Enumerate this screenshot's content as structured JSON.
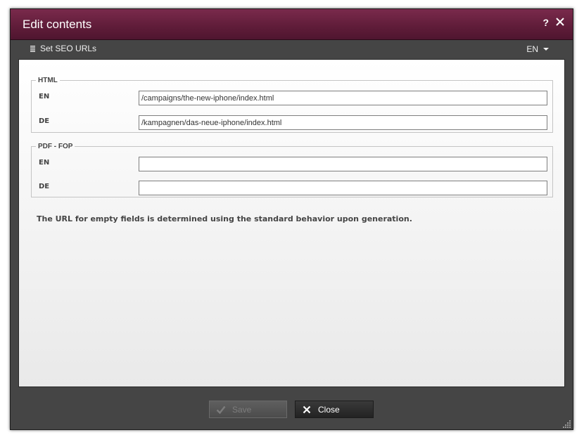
{
  "dialog": {
    "title": "Edit contents",
    "help_label": "?"
  },
  "toolbar": {
    "menu_label": "Set SEO URLs",
    "language": "EN"
  },
  "groups": [
    {
      "legend": "HTML",
      "rows": [
        {
          "label": "EN",
          "value": "/campaigns/the-new-iphone/index.html"
        },
        {
          "label": "DE",
          "value": "/kampagnen/das-neue-iphone/index.html"
        }
      ]
    },
    {
      "legend": "PDF - FOP",
      "rows": [
        {
          "label": "EN",
          "value": ""
        },
        {
          "label": "DE",
          "value": ""
        }
      ]
    }
  ],
  "info_text": "The URL for empty fields is determined using the standard behavior upon generation.",
  "footer": {
    "save_label": "Save",
    "close_label": "Close"
  },
  "colors": {
    "titlebar": "#611d3a",
    "body": "#454545"
  }
}
